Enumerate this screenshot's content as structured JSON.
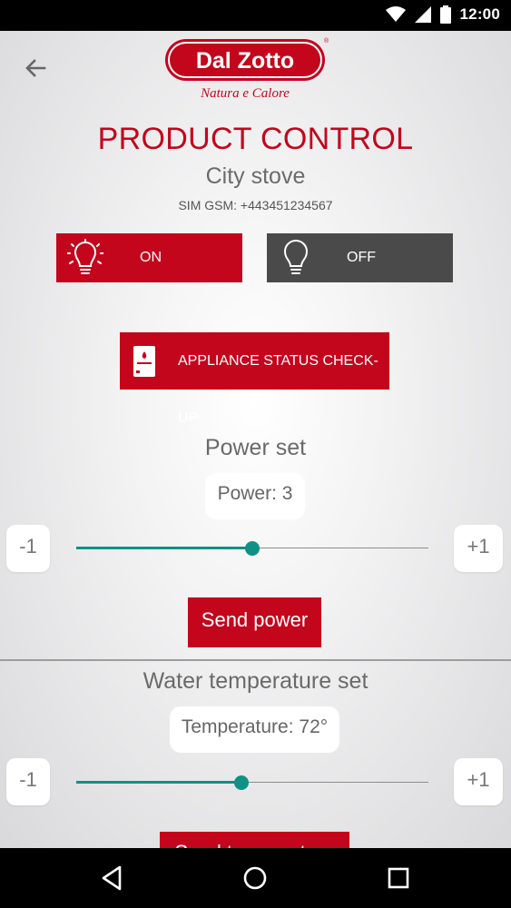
{
  "status_bar": {
    "time": "12:00"
  },
  "brand": {
    "name": "Dal Zotto",
    "tagline": "Natura e Calore",
    "color": "#c3061c"
  },
  "header": {
    "title": "PRODUCT CONTROL",
    "product": "City stove",
    "sim": "SIM GSM: +443451234567"
  },
  "power_buttons": {
    "on_label": "ON",
    "off_label": "OFF"
  },
  "status_check": {
    "label": "APPLIANCE STATUS CHECK-UP"
  },
  "power": {
    "section_title": "Power set",
    "display": "Power: 3",
    "minus_label": "-1",
    "plus_label": "+1",
    "slider_fraction": 0.5,
    "send_label": "Send power"
  },
  "water": {
    "section_title": "Water temperature set",
    "display": "Temperature: 72°",
    "minus_label": "-1",
    "plus_label": "+1",
    "slider_fraction": 0.47,
    "send_label": "Send temperature"
  },
  "accent_color": "#0f9186",
  "icons": [
    "back-arrow-icon",
    "lightbulb-on-icon",
    "lightbulb-off-icon",
    "stove-icon",
    "wifi-icon",
    "signal-icon",
    "battery-icon",
    "nav-back-icon",
    "nav-home-icon",
    "nav-recents-icon"
  ]
}
